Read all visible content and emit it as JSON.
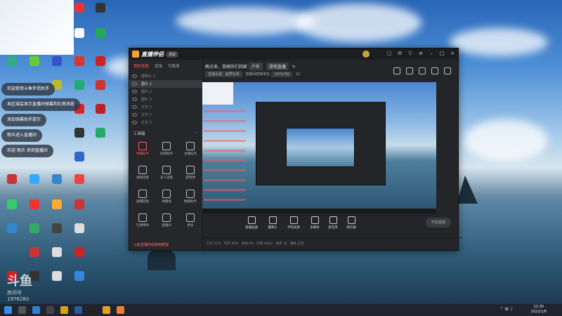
{
  "desktop": {
    "notifications": [
      "欢迎使用斗鱼伴侣助手",
      "本区域会显示直播间弹幕和礼物消息",
      "添加弹幕助手提示",
      "观众进入直播间",
      "欢迎 观众 来到直播间"
    ],
    "watermark": {
      "brand": "斗鱼",
      "label": "房间号",
      "room_id": "1976280"
    }
  },
  "app": {
    "name": "直播伴侣",
    "version_badge": "测试",
    "left_tabs": [
      "我的场景",
      "双场",
      "可换场"
    ],
    "sources": [
      "摄像头 1",
      "图片 1",
      "图片 2",
      "图片 3",
      "文字 1",
      "文字 2",
      "文字 3"
    ],
    "tools_title": "工具箱",
    "tools": [
      "弹幕助手",
      "房管助手",
      "主播任务",
      "视频连麦",
      "多人连麦",
      "游戏弹",
      "直播回放",
      "弹幕墙",
      "数据助手",
      "礼物特效",
      "直播间",
      "更多"
    ],
    "left_footer": "斗鱼直播伴侣使用教程",
    "title_line": "晚点来，我喊你们回家",
    "title_edit": "修改",
    "category_pill": "户外",
    "category_value": "游戏直播",
    "subline": [
      "直播设置 · 画质标准",
      "直播间复制地址",
      "1976280",
      "12"
    ],
    "bottom_buttons": [
      "直播画面",
      "摄像头",
      "手机投屏",
      "多媒体",
      "麦克风",
      "扬声器"
    ],
    "go_live": "开始直播",
    "status": [
      "CPU 12%",
      "内存 45%",
      "丢帧 0%",
      "码率 0kb/s",
      "帧率 30",
      "网络 正常"
    ]
  },
  "taskbar": {
    "time": "22:30",
    "date": "2022/1/8"
  },
  "colors": {
    "accent": "#ff5a5a",
    "brand": "#f2a13a"
  }
}
